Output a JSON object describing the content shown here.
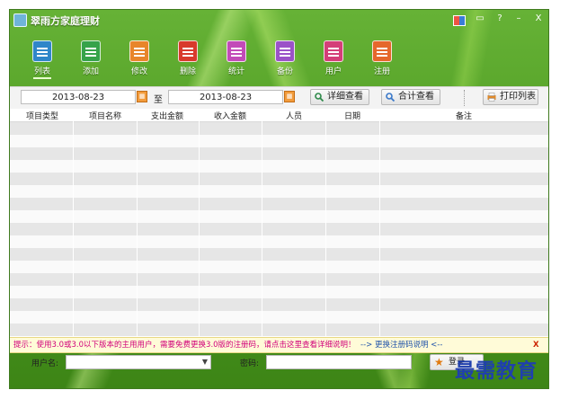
{
  "window": {
    "title": "翠雨方家庭理财"
  },
  "titlebar": {
    "skin": "skin-icon",
    "restore": "▭",
    "help": "?",
    "minimize": "–",
    "close": "X"
  },
  "toolbar": {
    "items": [
      {
        "label": "列表",
        "icon": "list-icon",
        "color": "#2f86c9"
      },
      {
        "label": "添加",
        "icon": "add-icon",
        "color": "#36a34a"
      },
      {
        "label": "修改",
        "icon": "edit-icon",
        "color": "#e8852a"
      },
      {
        "label": "删除",
        "icon": "delete-icon",
        "color": "#d83a2c"
      },
      {
        "label": "统计",
        "icon": "stats-icon",
        "color": "#c24bb8"
      },
      {
        "label": "备份",
        "icon": "backup-icon",
        "color": "#9b52c8"
      },
      {
        "label": "用户",
        "icon": "user-icon",
        "color": "#d43f78"
      },
      {
        "label": "注册",
        "icon": "register-icon",
        "color": "#e5672c"
      }
    ]
  },
  "filter": {
    "date_from": "2013-08-23",
    "to_label": "至",
    "date_to": "2013-08-23",
    "detail_button": "详细查看",
    "total_button": "合计查看",
    "print_button": "打印列表"
  },
  "table": {
    "columns": [
      "项目类型",
      "项目名称",
      "支出金额",
      "收入金额",
      "人员",
      "日期",
      "备注"
    ],
    "rows": []
  },
  "notice": {
    "message": "提示：使用3.0或3.0以下版本的主用用户，需要免费更换3.0版的注册码，请点击这里查看详细说明！",
    "link": "--> 更换注册码说明 <--",
    "close": "X"
  },
  "login": {
    "username_label": "用户名:",
    "password_label": "密码:",
    "login_button": "登录"
  },
  "watermark": "最需教育"
}
